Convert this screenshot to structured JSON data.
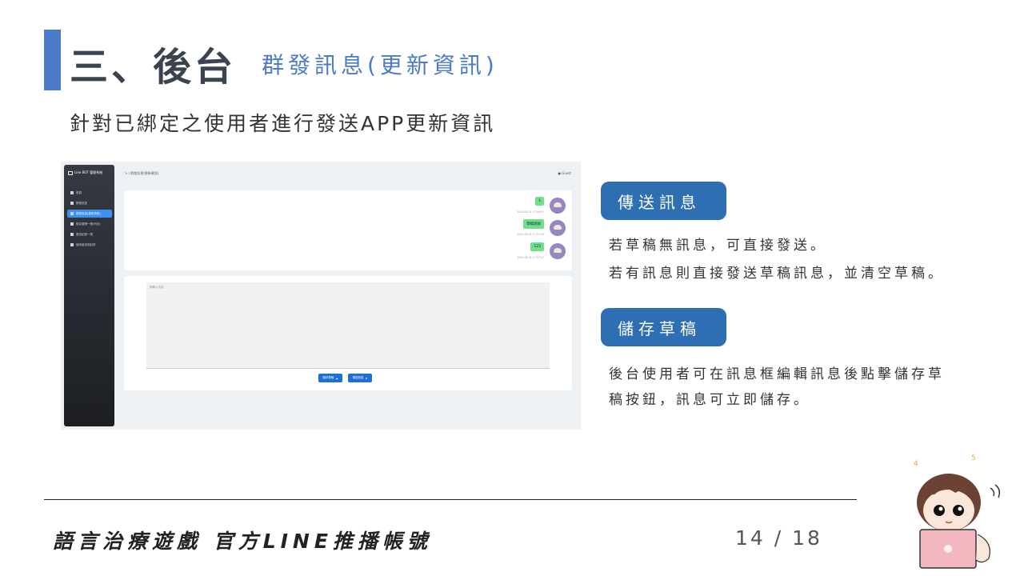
{
  "slide": {
    "title_main": "三、後台",
    "title_sub": "群發訊息(更新資訊)",
    "subtitle": "針對已綁定之使用者進行發送APP更新資訊"
  },
  "screenshot": {
    "app_name": "Line BOT 管理系統",
    "sidebar_items": [
      {
        "label": "首頁"
      },
      {
        "label": "群發訊息"
      },
      {
        "label": "群發訊息(更新資訊)"
      },
      {
        "label": "綁定管理一覽(列出)"
      },
      {
        "label": "發送紀錄一覽"
      },
      {
        "label": "使用者查詢記錄"
      }
    ],
    "breadcrumb": "> / 群發訊息(更新資訊)",
    "user_label": "Guest",
    "messages": [
      {
        "text": "1",
        "time": "2020-08-01 17:56:01"
      },
      {
        "text": "草稿測試",
        "time": "2020-08-01 17:57:43"
      },
      {
        "text": "123",
        "time": "2020-08-01 17:57:47"
      }
    ],
    "textarea_placeholder": "請輸入訊息",
    "save_button": "儲存草稿",
    "send_button": "傳送訊息"
  },
  "explanations": {
    "send_tag": "傳送訊息",
    "send_line1": "若草稿無訊息，可直接發送。",
    "send_line2": "若有訊息則直接發送草稿訊息，並清空草稿。",
    "save_tag": "儲存草稿",
    "save_line1": "後台使用者可在訊息框編輯訊息後點擊儲存草",
    "save_line2": "稿按鈕，訊息可立即儲存。"
  },
  "footer": {
    "title": "語言治療遊戲 官方LINE推播帳號",
    "page_number": "14 / 18"
  },
  "colors": {
    "accent": "#4a7ac9",
    "tag_blue": "#2d6fb2",
    "bubble_green": "#6ee08a"
  }
}
